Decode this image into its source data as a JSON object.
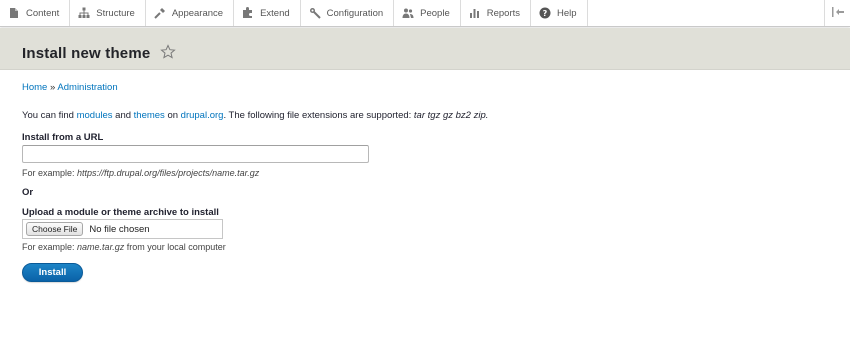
{
  "toolbar": {
    "items": [
      {
        "label": "Content",
        "icon": "content-icon"
      },
      {
        "label": "Structure",
        "icon": "structure-icon"
      },
      {
        "label": "Appearance",
        "icon": "appearance-icon"
      },
      {
        "label": "Extend",
        "icon": "extend-icon"
      },
      {
        "label": "Configuration",
        "icon": "configuration-icon"
      },
      {
        "label": "People",
        "icon": "people-icon"
      },
      {
        "label": "Reports",
        "icon": "reports-icon"
      },
      {
        "label": "Help",
        "icon": "help-icon"
      }
    ],
    "toggle_icon": "toolbar-orientation-icon"
  },
  "page": {
    "title": "Install new theme",
    "shortcut_icon": "star-icon"
  },
  "breadcrumb": {
    "home": "Home",
    "separator": "»",
    "admin": "Administration"
  },
  "intro": {
    "prefix": "You can find",
    "modules_link": "modules",
    "and": "and",
    "themes_link": "themes",
    "on": "on",
    "drupal_link": "drupal.org",
    "suffix": ". The following file extensions are supported:",
    "extensions": "tar tgz gz bz2 zip."
  },
  "url_field": {
    "label": "Install from a URL",
    "value": "",
    "placeholder": "",
    "desc_prefix": "For example:",
    "desc_example": "https://ftp.drupal.org/files/projects/name.tar.gz"
  },
  "or_label": "Or",
  "upload_field": {
    "label": "Upload a module or theme archive to install",
    "button": "Choose File",
    "status": "No file chosen",
    "desc_prefix": "For example:",
    "desc_example": "name.tar.gz",
    "desc_suffix": "from your local computer"
  },
  "submit": {
    "label": "Install"
  },
  "colors": {
    "link": "#0074bd",
    "header_band": "#e0e0d8",
    "primary_button": "#0a62a8"
  }
}
